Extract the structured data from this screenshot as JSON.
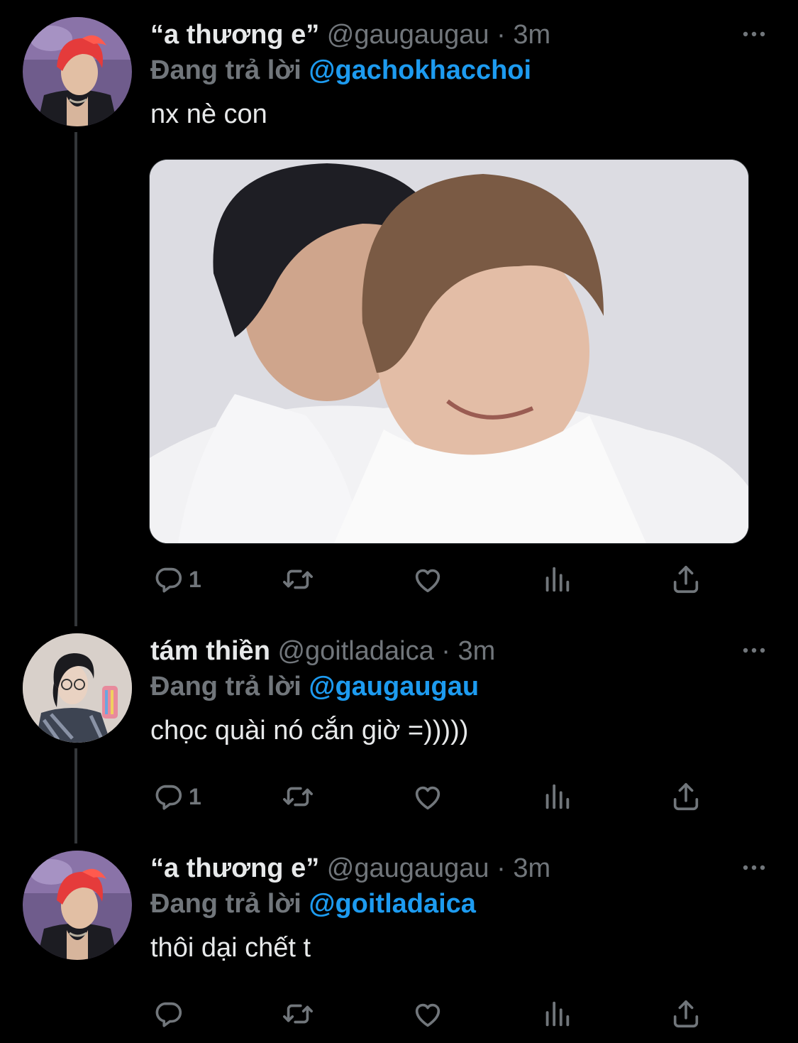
{
  "tweets": [
    {
      "display_name": "“a thương e”",
      "handle": "@gaugaugau",
      "separator": "·",
      "time": "3m",
      "reply_prefix": "Đang trả lời",
      "reply_to": "@gachokhacchoi",
      "text": "nx nè con",
      "has_media": true,
      "reply_count": "1",
      "avatar": "red-haired-performer-avatar"
    },
    {
      "display_name": "tám thiền",
      "handle": "@goitladaica",
      "separator": "·",
      "time": "3m",
      "reply_prefix": "Đang trả lời",
      "reply_to": "@gaugaugau",
      "text": "chọc quài nó cắn giờ =)))))",
      "has_media": false,
      "reply_count": "1",
      "avatar": "mirror-selfie-avatar"
    },
    {
      "display_name": "“a thương e”",
      "handle": "@gaugaugau",
      "separator": "·",
      "time": "3m",
      "reply_prefix": "Đang trả lời",
      "reply_to": "@goitladaica",
      "text": "thôi dại chết t",
      "has_media": false,
      "reply_count": "",
      "avatar": "red-haired-performer-avatar"
    }
  ],
  "icons": {
    "reply": "reply-icon",
    "retweet": "retweet-icon",
    "like": "like-icon",
    "views": "views-icon",
    "share": "share-icon",
    "more": "more-icon"
  },
  "colors": {
    "background": "#000000",
    "text": "#e7e9ea",
    "muted": "#71767b",
    "link": "#1d9bf0",
    "thread_line": "#333639"
  }
}
